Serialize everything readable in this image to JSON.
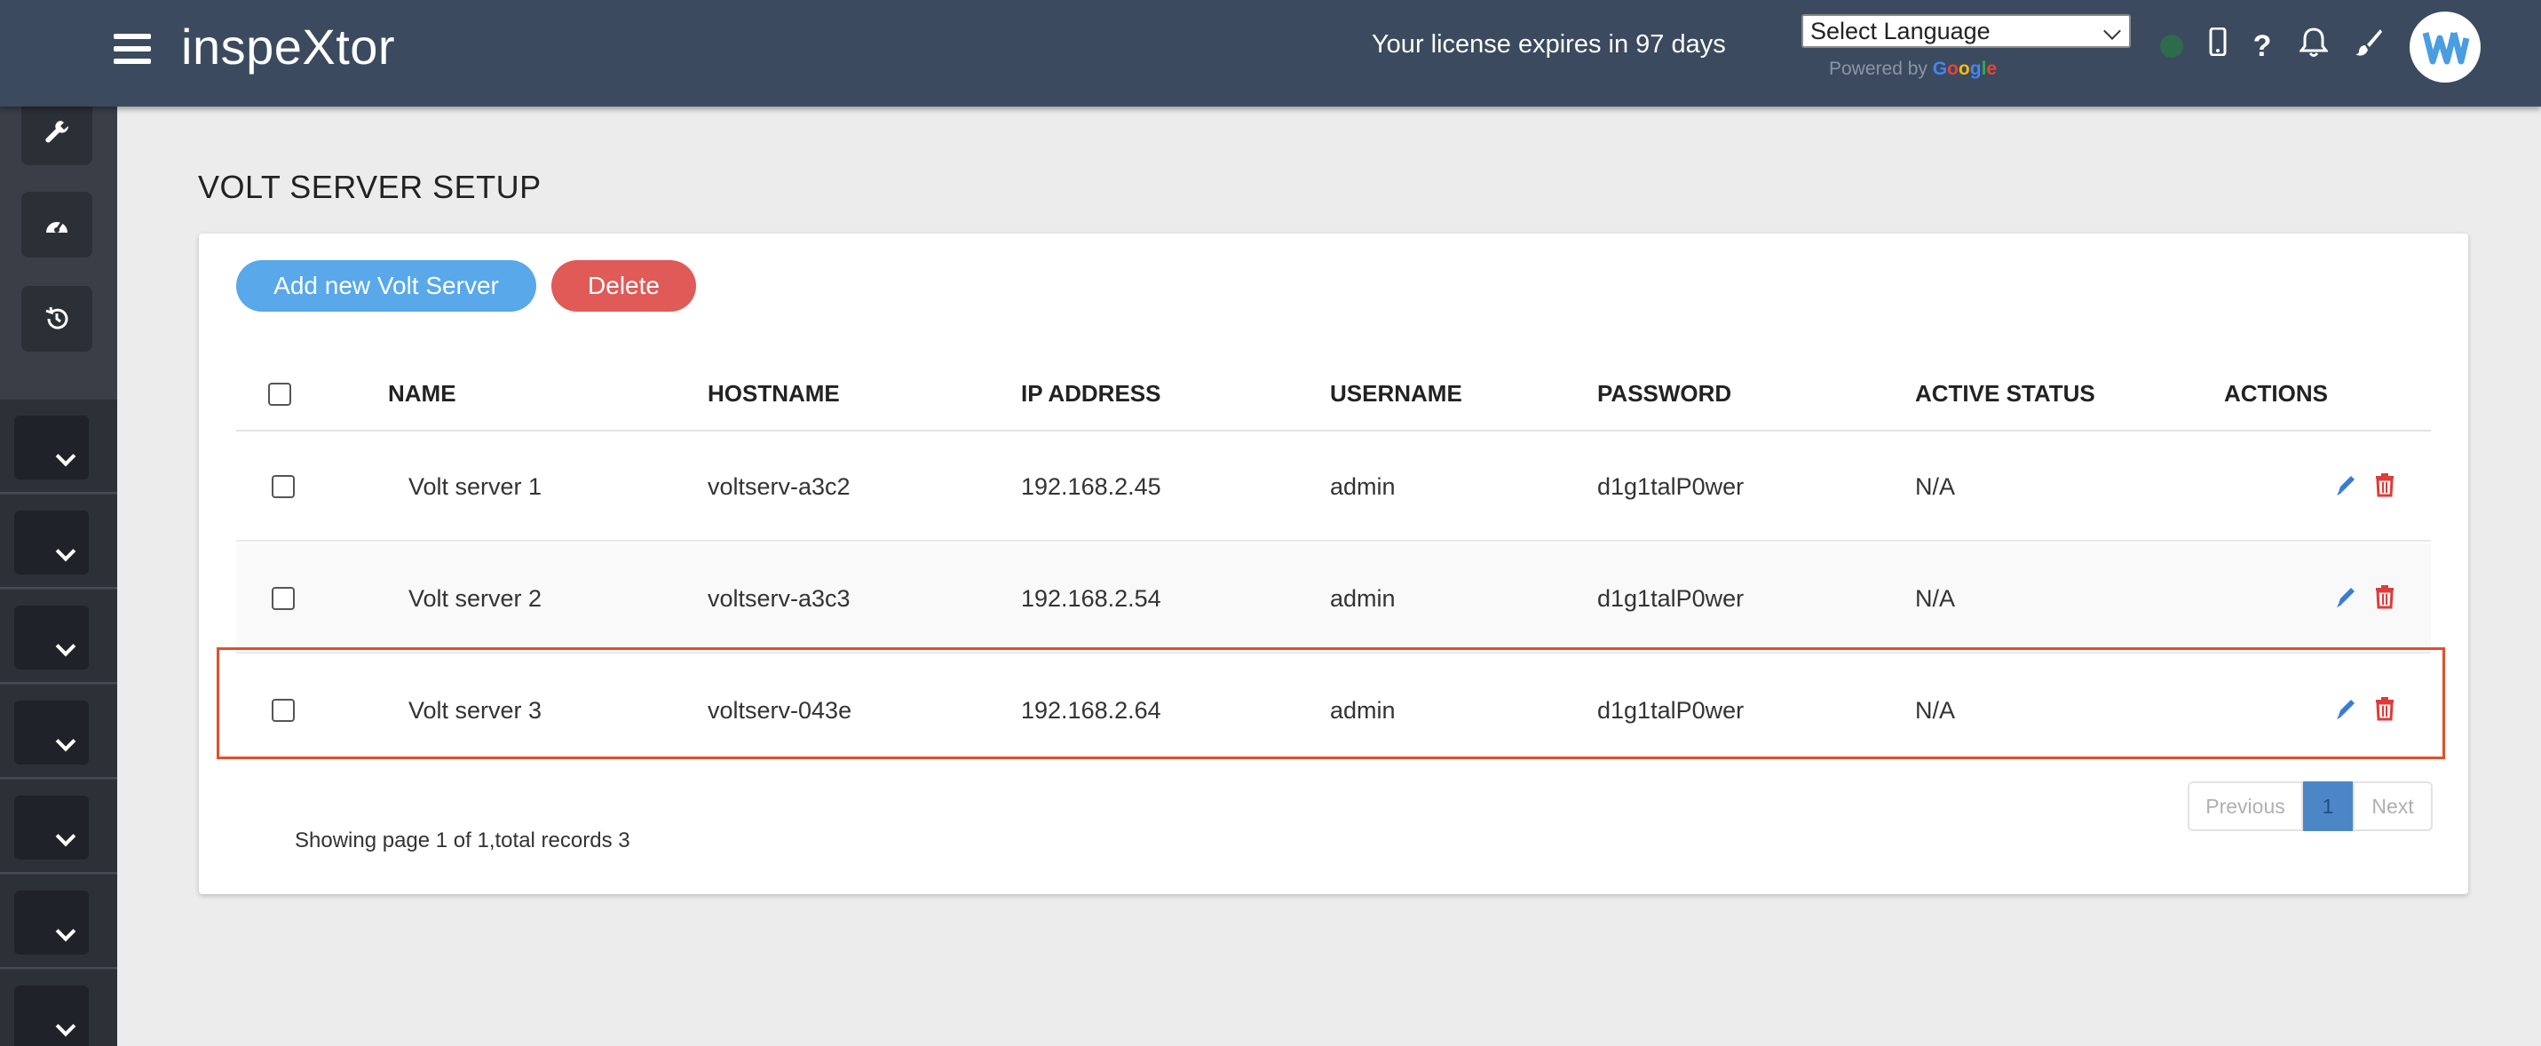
{
  "header": {
    "brand": "inspeXtor",
    "license": "Your license expires in 97 days",
    "language_select": "Select Language",
    "powered_by": "Powered by",
    "google": [
      "G",
      "o",
      "o",
      "g",
      "l",
      "e"
    ],
    "icons": [
      "mobile-icon",
      "help-icon",
      "bell-icon",
      "brush-icon"
    ]
  },
  "page": {
    "title": "VOLT SERVER SETUP"
  },
  "toolbar": {
    "add_label": "Add new Volt Server",
    "delete_label": "Delete"
  },
  "table": {
    "columns": [
      "NAME",
      "HOSTNAME",
      "IP ADDRESS",
      "USERNAME",
      "PASSWORD",
      "ACTIVE STATUS",
      "ACTIONS"
    ],
    "rows": [
      {
        "name": "Volt server 1",
        "hostname": "voltserv-a3c2",
        "ip": "192.168.2.45",
        "username": "admin",
        "password": "d1g1talP0wer",
        "status": "N/A"
      },
      {
        "name": "Volt server 2",
        "hostname": "voltserv-a3c3",
        "ip": "192.168.2.54",
        "username": "admin",
        "password": "d1g1talP0wer",
        "status": "N/A"
      },
      {
        "name": "Volt server 3",
        "hostname": "voltserv-043e",
        "ip": "192.168.2.64",
        "username": "admin",
        "password": "d1g1talP0wer",
        "status": "N/A"
      }
    ]
  },
  "footer": {
    "summary": "Showing page 1 of 1,total records 3"
  },
  "pagination": {
    "previous": "Previous",
    "current": "1",
    "next": "Next"
  },
  "colors": {
    "header": "#3b4a5e",
    "primary": "#58a8ea",
    "danger": "#e05a57",
    "highlight": "#e0502a"
  }
}
